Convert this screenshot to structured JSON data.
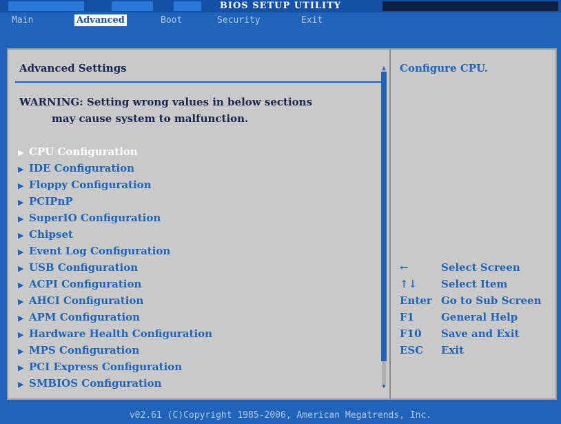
{
  "title": "BIOS SETUP UTILITY",
  "menu": {
    "items": [
      {
        "label": "Main"
      },
      {
        "label": "Advanced"
      },
      {
        "label": "Boot"
      },
      {
        "label": "Security"
      },
      {
        "label": "Exit"
      }
    ],
    "active": "Advanced"
  },
  "main": {
    "heading": "Advanced Settings",
    "warning": "WARNING: Setting wrong values in below sections\n         may cause system to malfunction.",
    "selected": "CPU Configuration",
    "items": [
      {
        "label": "CPU Configuration"
      },
      {
        "label": "IDE Configuration"
      },
      {
        "label": "Floppy Configuration"
      },
      {
        "label": "PCIPnP"
      },
      {
        "label": "SuperIO Configuration"
      },
      {
        "label": "Chipset"
      },
      {
        "label": "Event Log Configuration"
      },
      {
        "label": "USB Configuration"
      },
      {
        "label": "ACPI Configuration"
      },
      {
        "label": "AHCI Configuration"
      },
      {
        "label": "APM Configuration"
      },
      {
        "label": "Hardware Health Configuration"
      },
      {
        "label": "MPS Configuration"
      },
      {
        "label": "PCI Express Configuration"
      },
      {
        "label": "SMBIOS Configuration"
      }
    ]
  },
  "help": {
    "description": "Configure CPU.",
    "keys": [
      {
        "key": "←",
        "action": "Select Screen"
      },
      {
        "key": "↑↓",
        "action": "Select Item"
      },
      {
        "key": "Enter",
        "action": "Go to Sub Screen"
      },
      {
        "key": "F1",
        "action": "General Help"
      },
      {
        "key": "F10",
        "action": "Save and Exit"
      },
      {
        "key": "ESC",
        "action": "Exit"
      }
    ]
  },
  "footer": "v02.61 (C)Copyright 1985-2006, American Megatrends, Inc.",
  "colors": {
    "background": "#1f64b8",
    "panel": "#c9c9c9",
    "accent": "#1f64b8",
    "text_dark": "#1a2550",
    "selected_text": "#ffffff"
  }
}
